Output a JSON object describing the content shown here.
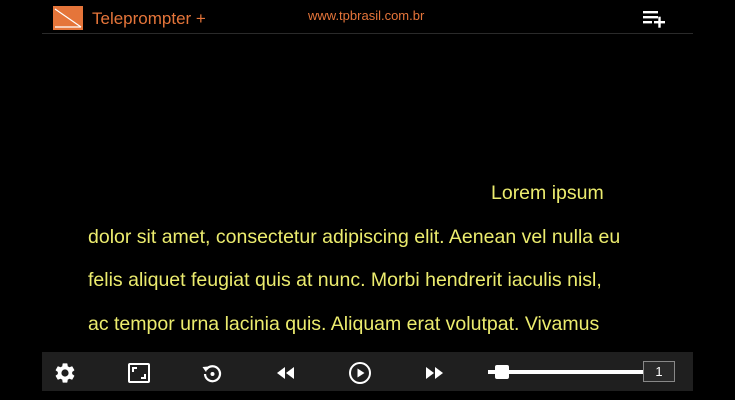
{
  "header": {
    "title": "Teleprompter +",
    "url": "www.tpbrasil.com.br",
    "logo_icon": "teleprompter-logo",
    "add_icon": "playlist-add-icon"
  },
  "script": {
    "lines": [
      "Lorem ipsum",
      "dolor sit amet, consectetur adipiscing elit. Aenean vel nulla eu",
      "felis aliquet feugiat quis at nunc. Morbi hendrerit iaculis nisl,",
      "ac tempor urna lacinia quis. Aliquam erat volutpat. Vivamus"
    ]
  },
  "controls": {
    "icons": [
      "settings-icon",
      "fullscreen-icon",
      "restart-icon",
      "rewind-icon",
      "play-icon",
      "fast-forward-icon"
    ],
    "speed_slider_position": 0.05,
    "speed_value": "1"
  },
  "colors": {
    "accent": "#e5753a",
    "script_text": "#ecec6e",
    "background": "#000000",
    "control_bar": "#1f1f1f"
  }
}
